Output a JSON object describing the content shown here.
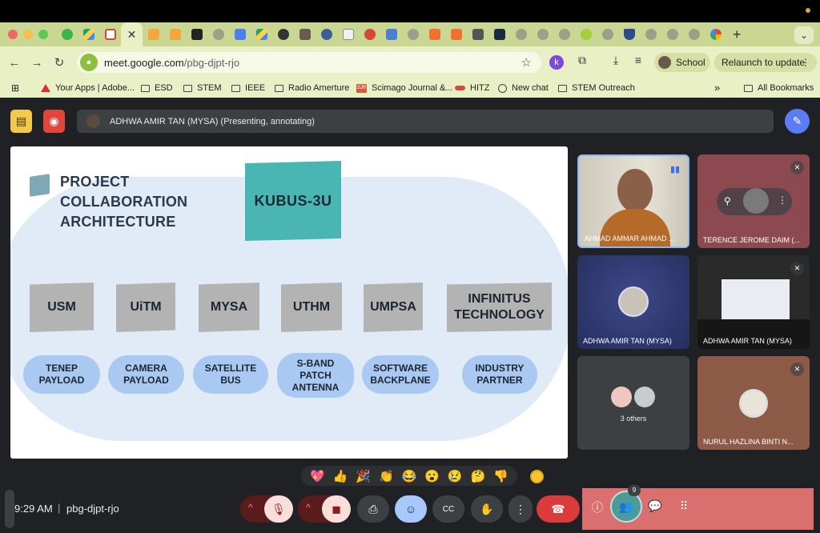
{
  "browser": {
    "url_host": "meet.google.com",
    "url_path": "/pbg-djpt-rjo",
    "profile_label": "School",
    "relaunch_label": "Relaunch to update",
    "relaunch_menu": "⋮",
    "new_tab_label": "+",
    "tab_close": "✕",
    "tab_menu": "⌄",
    "nav": {
      "back": "←",
      "forward": "→",
      "reload": "↻"
    },
    "star": "☆",
    "extensions": [
      "k",
      "⧉",
      "⤓",
      "≡"
    ],
    "bookmarks": [
      {
        "label": "Your Apps | Adobe...",
        "icon": "adobe-icon"
      },
      {
        "label": "ESD",
        "icon": "folder-icon"
      },
      {
        "label": "STEM",
        "icon": "folder-icon"
      },
      {
        "label": "IEEE",
        "icon": "folder-icon"
      },
      {
        "label": "Radio Amerture",
        "icon": "folder-icon"
      },
      {
        "label": "Scimago Journal &...",
        "icon": "sjr-icon"
      },
      {
        "label": "HITZ",
        "icon": "hitz-icon"
      },
      {
        "label": "New chat",
        "icon": "chatgpt-icon"
      },
      {
        "label": "STEM Outreach",
        "icon": "folder-icon"
      }
    ],
    "bookmarks_more": "»",
    "all_bookmarks": "All Bookmarks",
    "sjr_badge": "SJR"
  },
  "meet": {
    "presenter_bar": "ADHWA AMIR TAN (MYSA) (Presenting, annotating)",
    "time": "9:29 AM",
    "separator": "|",
    "meeting_code": "pbg-djpt-rjo",
    "participant_count": "9",
    "reactions": [
      "💖",
      "👍",
      "🎉",
      "👏",
      "😂",
      "😮",
      "😢",
      "🤔",
      "👎"
    ],
    "tiles": [
      {
        "name": "AHMAD AMMAR AHMAD ...",
        "speaking": true
      },
      {
        "name": "TERENCE JEROME DAIM (...",
        "muted": true
      },
      {
        "name": "ADHWA AMIR TAN (MYSA)"
      },
      {
        "name": "ADHWA AMIR TAN (MYSA)",
        "muted": true
      },
      {
        "name": "3 others"
      },
      {
        "name": "NURUL HAZLINA BINTI N...",
        "muted": true
      }
    ],
    "controls": {
      "caret": "^",
      "mic_off": "🎙",
      "cam_off": "◼",
      "present": "⎙",
      "emoji": "☺",
      "cc": "CC",
      "hand": "✋",
      "more": "⋮",
      "leave": "☎",
      "info": "ⓘ",
      "people": "👥",
      "chat": "💬",
      "activities": "⠿"
    }
  },
  "slide": {
    "title_lines": [
      "PROJECT",
      "COLLABORATION",
      "ARCHITECTURE"
    ],
    "center_label": "KUBUS-3U",
    "institutions": [
      {
        "name": "USM",
        "role": [
          "TENEP",
          "PAYLOAD"
        ]
      },
      {
        "name": "UiTM",
        "role": [
          "CAMERA",
          "PAYLOAD"
        ]
      },
      {
        "name": "MYSA",
        "role": [
          "SATELLITE",
          "BUS"
        ]
      },
      {
        "name": "UTHM",
        "role": [
          "S-BAND",
          "PATCH",
          "ANTENNA"
        ]
      },
      {
        "name": "UMPSA",
        "role": [
          "SOFTWARE",
          "BACKPLANE"
        ]
      },
      {
        "name_lines": [
          "INFINITUS",
          "TECHNOLOGY"
        ],
        "role": [
          "INDUSTRY",
          "PARTNER"
        ]
      }
    ]
  },
  "colors": {
    "tab_strip": "#c9d792",
    "toolbar": "#e9f0c6",
    "meet_bg": "#202124",
    "slide_teal": "#49b6b3",
    "slide_pill": "#a9c9f2",
    "slide_box": "#b3b3b3",
    "leave_red": "#dc3b3b",
    "panel_highlight": "#d96f6f"
  }
}
